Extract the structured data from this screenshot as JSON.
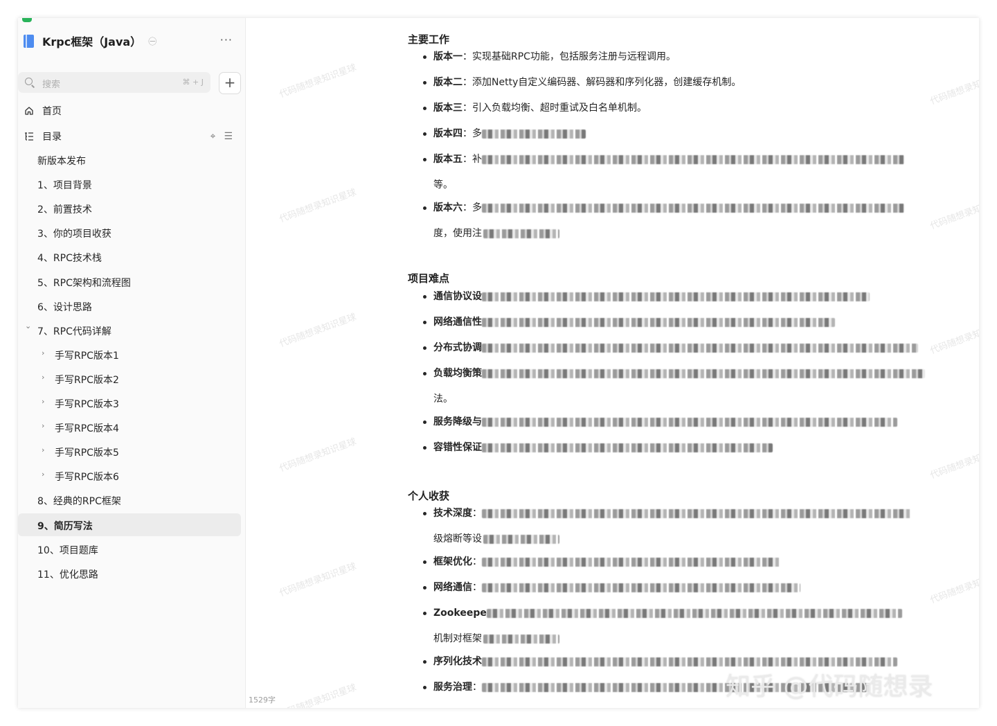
{
  "sidebar": {
    "book_title": "Krpc框架（Java）",
    "search_placeholder": "搜索",
    "search_shortcut": "⌘ + J",
    "add_label": "+",
    "home_label": "首页",
    "toc_label": "目录",
    "toc_items": [
      {
        "label": "新版本发布"
      },
      {
        "label": "1、项目背景"
      },
      {
        "label": "2、前置技术"
      },
      {
        "label": "3、你的项目收获"
      },
      {
        "label": "4、RPC技术栈"
      },
      {
        "label": "5、RPC架构和流程图"
      },
      {
        "label": "6、设计思路"
      },
      {
        "label": "7、RPC代码详解"
      },
      {
        "label": "手写RPC版本1"
      },
      {
        "label": "手写RPC版本2"
      },
      {
        "label": "手写RPC版本3"
      },
      {
        "label": "手写RPC版本4"
      },
      {
        "label": "手写RPC版本5"
      },
      {
        "label": "手写RPC版本6"
      },
      {
        "label": "8、经典的RPC框架"
      },
      {
        "label": "9、简历写法"
      },
      {
        "label": "10、项目题库"
      },
      {
        "label": "11、优化思路"
      }
    ]
  },
  "main": {
    "word_count": "1529字",
    "sections": [
      {
        "title": "主要工作",
        "bullets": [
          {
            "lead": "版本一",
            "text": "：实现基础RPC功能，包括服务注册与远程调用。"
          },
          {
            "lead": "版本二",
            "text": "：添加Netty自定义编码器、解码器和序列化器，创建缓存机制。"
          },
          {
            "lead": "版本三",
            "text": "：引入负载均衡、超时重试及白名单机制。"
          },
          {
            "lead": "版本四",
            "text": "：多"
          },
          {
            "lead": "版本五",
            "text": "：补",
            "cont": "等。"
          },
          {
            "lead": "版本六",
            "text": "：多",
            "cont": "度，使用注"
          }
        ]
      },
      {
        "title": "项目难点",
        "bullets": [
          {
            "lead": "通信协议设",
            "text": ""
          },
          {
            "lead": "网络通信性",
            "text": ""
          },
          {
            "lead": "分布式协调",
            "text": ""
          },
          {
            "lead": "负载均衡策",
            "text": "",
            "cont": "法。"
          },
          {
            "lead": "服务降级与",
            "text": ""
          },
          {
            "lead": "容错性保证",
            "text": ""
          }
        ]
      },
      {
        "title": "个人收获",
        "bullets": [
          {
            "lead": "技术深度",
            "text": "：",
            "cont": "级熔断等设"
          },
          {
            "lead": "框架优化",
            "text": "："
          },
          {
            "lead": "网络通信",
            "text": "："
          },
          {
            "lead": "Zookeepe",
            "text": "",
            "cont": "机制对框架"
          },
          {
            "lead": "序列化技术",
            "text": ""
          },
          {
            "lead": "服务治理",
            "text": "："
          }
        ]
      }
    ]
  },
  "watermark_text": "代码随想录知识星球",
  "zhihu_watermark": "知乎 @代码随想录"
}
